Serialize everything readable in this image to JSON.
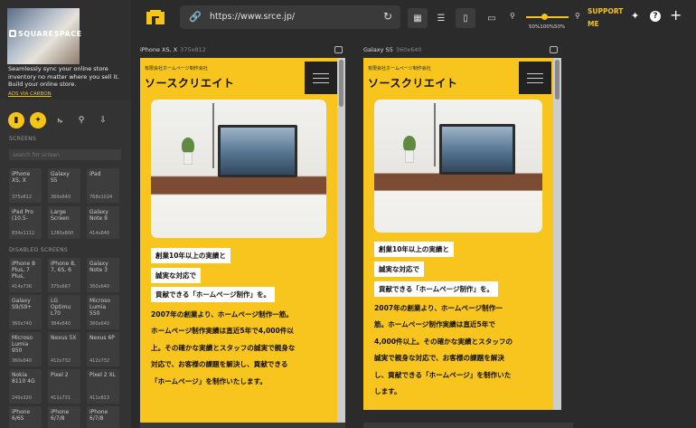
{
  "ad": {
    "brand": "SQUARESPACE",
    "text": "Seamlessly sync your online store inventory no matter where you sell it. Build your online store.",
    "via": "ADS VIA CARBON"
  },
  "sidebar": {
    "screens_label": "SCREENS",
    "search_placeholder": "search for screen",
    "disabled_label": "DISABLED SCREENS",
    "screens": [
      {
        "name": "iPhone XS, X",
        "size": "375x812"
      },
      {
        "name": "Galaxy S5",
        "size": "360x640"
      },
      {
        "name": "iPad",
        "size": "768x1024"
      },
      {
        "name": "iPad Pro (10.5-",
        "size": "834x1112"
      },
      {
        "name": "Large Screen",
        "size": "1280x800"
      },
      {
        "name": "Galaxy Note 9",
        "size": "414x846"
      }
    ],
    "disabled": [
      {
        "name": "iPhone 8 Plus, 7 Plus,",
        "size": "414x736"
      },
      {
        "name": "iPhone 8, 7, 6S, 6",
        "size": "375x667"
      },
      {
        "name": "Galaxy Note 3",
        "size": "360x640"
      },
      {
        "name": "Galaxy S9/S9+",
        "size": "360x740"
      },
      {
        "name": "LG Optimu L70",
        "size": "384x640"
      },
      {
        "name": "Microso Lumia 550",
        "size": "360x640"
      },
      {
        "name": "Microso Lumia 950",
        "size": "360x640"
      },
      {
        "name": "Nexus 5X",
        "size": "412x732"
      },
      {
        "name": "Nexus 6P",
        "size": "412x732"
      },
      {
        "name": "Nokia 8110 4G",
        "size": "240x320"
      },
      {
        "name": "Pixel 2",
        "size": "411x731"
      },
      {
        "name": "Pixel 2 XL",
        "size": "411x823"
      },
      {
        "name": "iPhone 6/6S",
        "size": ""
      },
      {
        "name": "iPhone 6/7/8",
        "size": ""
      },
      {
        "name": "iPhone 6/7/8",
        "size": ""
      }
    ]
  },
  "toolbar": {
    "url": "https://www.srce.jp/",
    "zoom_labels": "50%100%50%",
    "zoom_value": 0.5,
    "support_line1": "SUPPORT",
    "support_line2": "ME"
  },
  "devices": [
    {
      "name": "iPhone XS, X",
      "size": "375x812"
    },
    {
      "name": "Galaxy S5",
      "size": "360x640"
    }
  ],
  "site": {
    "company": "有限会社ホームページ制作会社",
    "brand": "ソースクリエイト",
    "tag1": "創業10年以上の実績と",
    "tag2": "誠実な対応で",
    "tag3": "貢献できる「ホームページ制作」を。",
    "body_a": [
      "2007年の創業より、ホームページ制作一筋。",
      "ホームページ制作実績は直近5年で4,000件以",
      "上。その確かな実績とスタッフの誠実で親身な",
      "対応で、お客様の課題を解決し、貢献できる",
      "「ホームページ」を制作いたします。"
    ],
    "body_b": [
      "2007年の創業より、ホームページ制作一",
      "筋。ホームページ制作実績は直近5年で",
      "4,000件以上。その確かな実績とスタッフの",
      "誠実で親身な対応で、お客様の課題を解決",
      "し、貢献できる「ホームページ」を制作いた",
      "します。"
    ]
  }
}
